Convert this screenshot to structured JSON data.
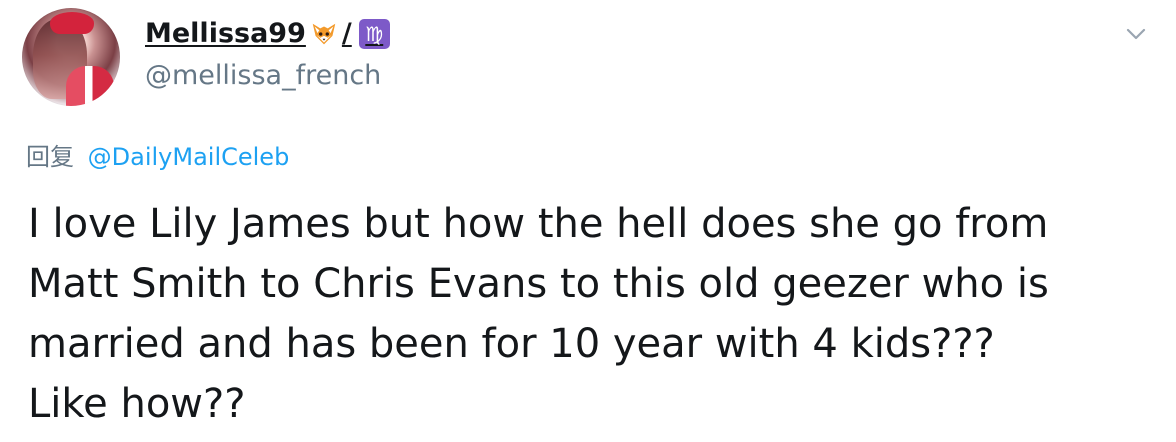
{
  "tweet": {
    "display_name": "Mellissa99",
    "display_name_separator": "/",
    "fox_icon": "fox-emoji-icon",
    "virgo_icon": "virgo-zodiac-icon",
    "virgo_symbol": "♍",
    "username": "@mellissa_french",
    "reply_prefix": "回复",
    "reply_to": "@DailyMailCeleb",
    "text_lines": [
      "I love Lily James but how the hell does she go from",
      "Matt Smith to Chris Evans to this old geezer who is",
      "married and has been for 10 year with 4 kids???",
      "Like how??"
    ],
    "colors": {
      "text": "#14171a",
      "muted": "#657786",
      "link": "#1da1f2",
      "virgo_bg": "#7d5ac8"
    }
  }
}
